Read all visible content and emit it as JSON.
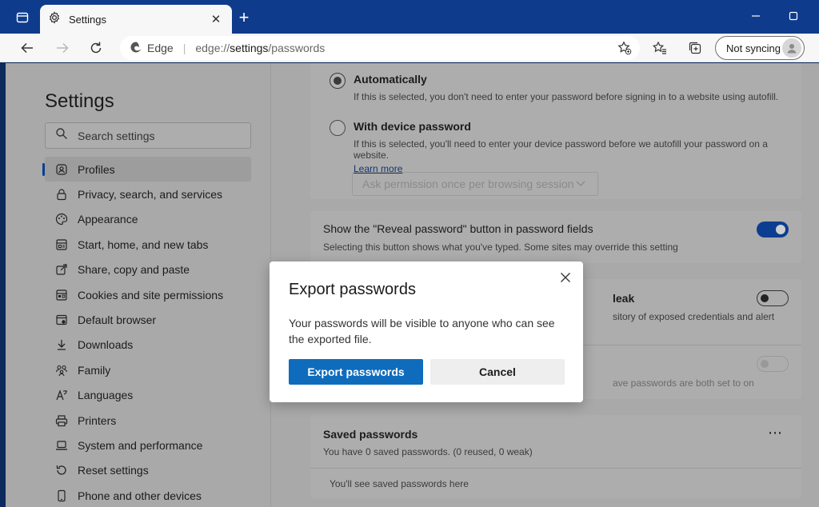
{
  "window": {
    "tab_title": "Settings",
    "icons": {
      "window_menu": "window-menu-icon",
      "tab": "gear-icon",
      "new_tab": "plus-icon",
      "minimize": "minimize-icon",
      "maximize": "maximize-icon"
    }
  },
  "address_bar": {
    "site_label": "Edge",
    "url_scheme": "edge://",
    "url_host": "settings",
    "url_path": "/passwords",
    "profile_label": "Not syncing"
  },
  "sidebar": {
    "title": "Settings",
    "search_placeholder": "Search settings",
    "items": [
      {
        "label": "Profiles",
        "icon": "profile-icon",
        "active": true
      },
      {
        "label": "Privacy, search, and services",
        "icon": "lock-icon"
      },
      {
        "label": "Appearance",
        "icon": "appearance-icon"
      },
      {
        "label": "Start, home, and new tabs",
        "icon": "start-icon"
      },
      {
        "label": "Share, copy and paste",
        "icon": "share-icon"
      },
      {
        "label": "Cookies and site permissions",
        "icon": "cookies-icon"
      },
      {
        "label": "Default browser",
        "icon": "browser-icon"
      },
      {
        "label": "Downloads",
        "icon": "download-icon"
      },
      {
        "label": "Family",
        "icon": "family-icon"
      },
      {
        "label": "Languages",
        "icon": "languages-icon"
      },
      {
        "label": "Printers",
        "icon": "printer-icon"
      },
      {
        "label": "System and performance",
        "icon": "laptop-icon"
      },
      {
        "label": "Reset settings",
        "icon": "reset-icon"
      },
      {
        "label": "Phone and other devices",
        "icon": "phone-icon"
      }
    ]
  },
  "main": {
    "autofill": {
      "automatically_title": "Automatically",
      "automatically_desc": "If this is selected, you don't need to enter your password before signing in to a website using autofill.",
      "device_password_title": "With device password",
      "device_password_desc": "If this is selected, you'll need to enter your device password before we autofill your password on a website.",
      "learn_more": "Learn more",
      "select_value": "Ask permission once per browsing session"
    },
    "reveal": {
      "title": "Show the \"Reveal password\" button in password fields",
      "desc": "Selecting this button shows what you've typed. Some sites may override this setting"
    },
    "leak": {
      "title_fragment": "leak",
      "desc_fragment": "sitory of exposed credentials and alert"
    },
    "strong": {
      "desc_fragment": "ave passwords are both set to on"
    },
    "saved": {
      "title": "Saved passwords",
      "summary": "You have 0 saved passwords. (0 reused, 0 weak)",
      "empty": "You'll see saved passwords here",
      "more": "⋯"
    }
  },
  "dialog": {
    "title": "Export passwords",
    "body": "Your passwords will be visible to anyone who can see the exported file.",
    "primary_label": "Export passwords",
    "secondary_label": "Cancel"
  },
  "colors": {
    "titlebar": "#0f3b8c",
    "accent": "#0f6cbd",
    "overlay_page": "#a9a9a9"
  }
}
